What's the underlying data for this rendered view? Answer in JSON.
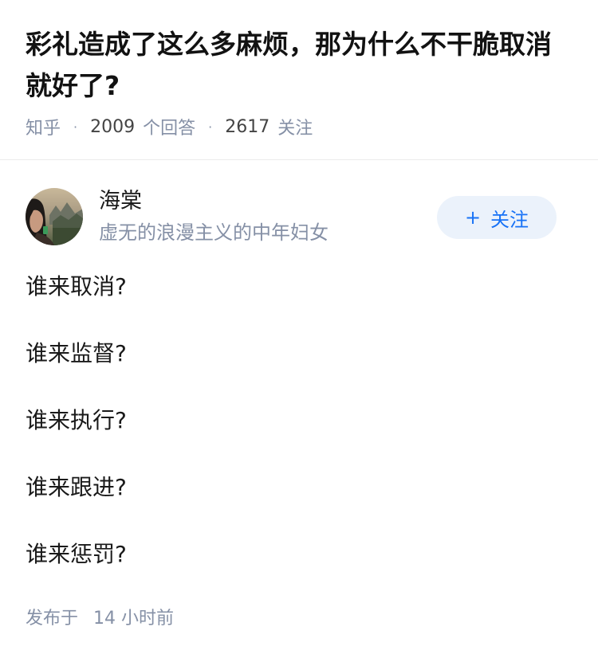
{
  "question": {
    "title": "彩礼造成了这么多麻烦，那为什么不干脆取消就好了?",
    "source": "知乎",
    "answers_count": "2009",
    "answers_label": "个回答",
    "followers_count": "2617",
    "followers_label": "关注"
  },
  "author": {
    "name": "海棠",
    "bio": "虚无的浪漫主义的中年妇女",
    "avatar_icon": "avatar-photo",
    "follow_button": {
      "icon": "+",
      "label": "关注",
      "bg_color": "#ebf2fb",
      "text_color": "#1772f6"
    }
  },
  "answer": {
    "lines": [
      "谁来取消?",
      "谁来监督?",
      "谁来执行?",
      "谁来跟进?",
      "谁来惩罚?"
    ],
    "published_label": "发布于",
    "published_num": "14",
    "published_unit": "小时前"
  }
}
